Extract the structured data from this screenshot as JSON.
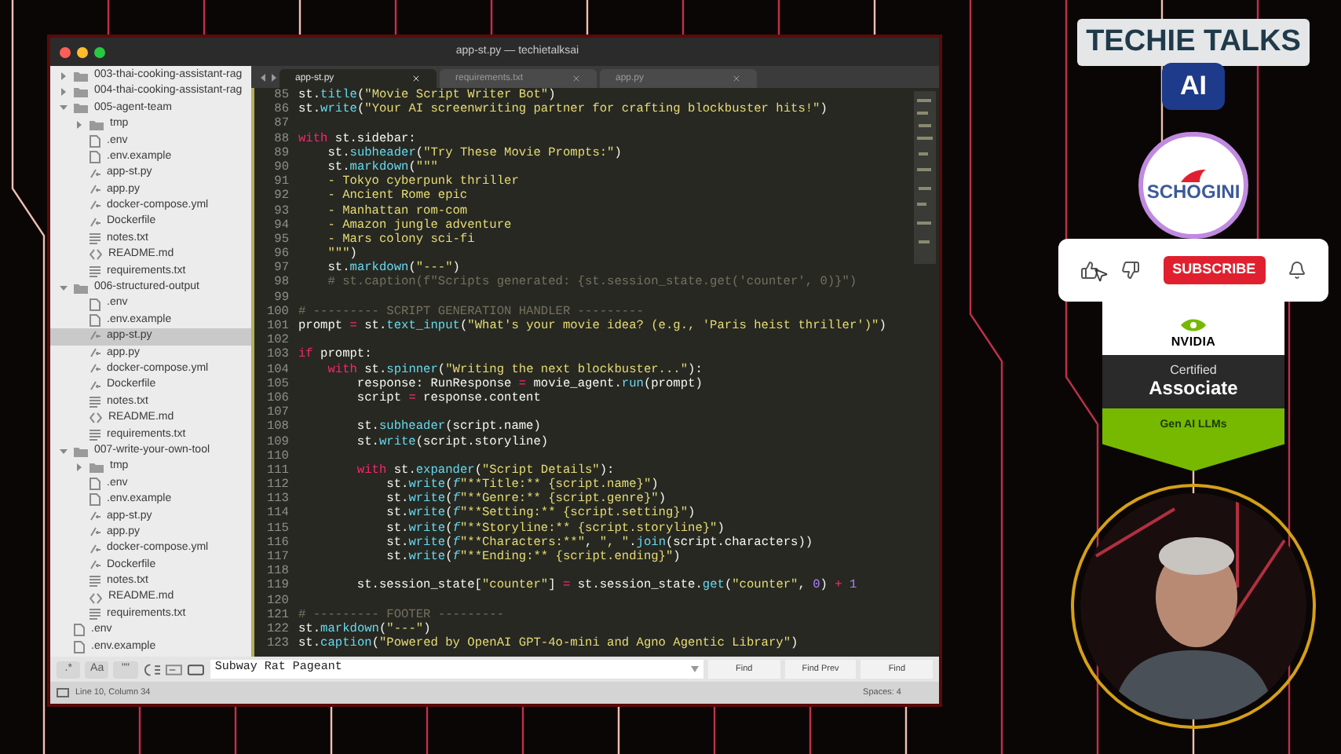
{
  "window": {
    "title": "app-st.py — techietalksai"
  },
  "sidebar": {
    "items": [
      {
        "label": "003-thai-cooking-assistant-rag",
        "kind": "folder",
        "expanded": false,
        "selected": false
      },
      {
        "label": "004-thai-cooking-assistant-rag",
        "kind": "folder",
        "expanded": false,
        "selected": false
      },
      {
        "label": "005-agent-team",
        "kind": "folder",
        "expanded": true,
        "selected": false,
        "children": [
          {
            "label": "tmp",
            "kind": "folder",
            "expanded": false,
            "selected": false
          },
          {
            "label": ".env",
            "kind": "file",
            "selected": false
          },
          {
            "label": ".env.example",
            "kind": "file",
            "selected": false
          },
          {
            "label": "app-st.py",
            "kind": "script",
            "selected": false
          },
          {
            "label": "app.py",
            "kind": "script",
            "selected": false
          },
          {
            "label": "docker-compose.yml",
            "kind": "script",
            "selected": false
          },
          {
            "label": "Dockerfile",
            "kind": "script",
            "selected": false
          },
          {
            "label": "notes.txt",
            "kind": "text",
            "selected": false
          },
          {
            "label": "README.md",
            "kind": "markup",
            "selected": false
          },
          {
            "label": "requirements.txt",
            "kind": "text",
            "selected": false
          }
        ]
      },
      {
        "label": "006-structured-output",
        "kind": "folder",
        "expanded": true,
        "selected": false,
        "children": [
          {
            "label": ".env",
            "kind": "file",
            "selected": false
          },
          {
            "label": ".env.example",
            "kind": "file",
            "selected": false
          },
          {
            "label": "app-st.py",
            "kind": "script",
            "selected": true
          },
          {
            "label": "app.py",
            "kind": "script",
            "selected": false
          },
          {
            "label": "docker-compose.yml",
            "kind": "script",
            "selected": false
          },
          {
            "label": "Dockerfile",
            "kind": "script",
            "selected": false
          },
          {
            "label": "notes.txt",
            "kind": "text",
            "selected": false
          },
          {
            "label": "README.md",
            "kind": "markup",
            "selected": false
          },
          {
            "label": "requirements.txt",
            "kind": "text",
            "selected": false
          }
        ]
      },
      {
        "label": "007-write-your-own-tool",
        "kind": "folder",
        "expanded": true,
        "selected": false,
        "children": [
          {
            "label": "tmp",
            "kind": "folder",
            "expanded": false,
            "selected": false
          },
          {
            "label": ".env",
            "kind": "file",
            "selected": false
          },
          {
            "label": ".env.example",
            "kind": "file",
            "selected": false
          },
          {
            "label": "app-st.py",
            "kind": "script",
            "selected": false
          },
          {
            "label": "app.py",
            "kind": "script",
            "selected": false
          },
          {
            "label": "docker-compose.yml",
            "kind": "script",
            "selected": false
          },
          {
            "label": "Dockerfile",
            "kind": "script",
            "selected": false
          },
          {
            "label": "notes.txt",
            "kind": "text",
            "selected": false
          },
          {
            "label": "README.md",
            "kind": "markup",
            "selected": false
          },
          {
            "label": "requirements.txt",
            "kind": "text",
            "selected": false
          }
        ]
      },
      {
        "label": ".env",
        "kind": "file",
        "selected": false
      },
      {
        "label": ".env.example",
        "kind": "file",
        "selected": false
      }
    ]
  },
  "tabs": [
    {
      "label": "app-st.py",
      "selected": true
    },
    {
      "label": "requirements.txt",
      "selected": false
    },
    {
      "label": "app.py",
      "selected": false
    }
  ],
  "editor": {
    "lines": [
      {
        "number": "85",
        "tokens": [
          {
            "kind": "plain",
            "text": "st."
          },
          {
            "kind": "call",
            "text": "title"
          },
          {
            "kind": "plain",
            "text": "("
          },
          {
            "kind": "string",
            "text": "\"Movie Script Writer Bot\""
          },
          {
            "kind": "plain",
            "text": ")"
          }
        ]
      },
      {
        "number": "86",
        "tokens": [
          {
            "kind": "plain",
            "text": "st."
          },
          {
            "kind": "call",
            "text": "write"
          },
          {
            "kind": "plain",
            "text": "("
          },
          {
            "kind": "string",
            "text": "\"Your AI screenwriting partner for crafting blockbuster hits!\""
          },
          {
            "kind": "plain",
            "text": ")"
          }
        ]
      },
      {
        "number": "87"
      },
      {
        "number": "88",
        "tokens": [
          {
            "kind": "keyword",
            "text": "with"
          },
          {
            "kind": "plain",
            "text": " st.sidebar:"
          }
        ]
      },
      {
        "number": "89",
        "tokens": [
          {
            "kind": "plain",
            "text": "    st."
          },
          {
            "kind": "call",
            "text": "subheader"
          },
          {
            "kind": "plain",
            "text": "("
          },
          {
            "kind": "string",
            "text": "\"Try These Movie Prompts:\""
          },
          {
            "kind": "plain",
            "text": ")"
          }
        ]
      },
      {
        "number": "90",
        "tokens": [
          {
            "kind": "plain",
            "text": "    st."
          },
          {
            "kind": "call",
            "text": "markdown"
          },
          {
            "kind": "plain",
            "text": "("
          },
          {
            "kind": "string",
            "text": "\"\"\""
          }
        ]
      },
      {
        "number": "91",
        "tokens": [
          {
            "kind": "string",
            "text": "    - Tokyo cyberpunk thriller"
          }
        ]
      },
      {
        "number": "92",
        "tokens": [
          {
            "kind": "string",
            "text": "    - Ancient Rome epic"
          }
        ]
      },
      {
        "number": "93",
        "tokens": [
          {
            "kind": "string",
            "text": "    - Manhattan rom-com"
          }
        ]
      },
      {
        "number": "94",
        "tokens": [
          {
            "kind": "string",
            "text": "    - Amazon jungle adventure"
          }
        ]
      },
      {
        "number": "95",
        "tokens": [
          {
            "kind": "string",
            "text": "    - Mars colony sci-fi"
          }
        ]
      },
      {
        "number": "96",
        "tokens": [
          {
            "kind": "string",
            "text": "    \"\"\""
          },
          {
            "kind": "plain",
            "text": ")"
          }
        ]
      },
      {
        "number": "97",
        "tokens": [
          {
            "kind": "plain",
            "text": "    st."
          },
          {
            "kind": "call",
            "text": "markdown"
          },
          {
            "kind": "plain",
            "text": "("
          },
          {
            "kind": "string",
            "text": "\"---\""
          },
          {
            "kind": "plain",
            "text": ")"
          }
        ]
      },
      {
        "number": "98",
        "tokens": [
          {
            "kind": "comment",
            "text": "    # st.caption(f\"Scripts generated: {st.session_state.get('counter', 0)}\")"
          }
        ]
      },
      {
        "number": "99"
      },
      {
        "number": "100",
        "tokens": [
          {
            "kind": "comment",
            "text": "# --------- SCRIPT GENERATION HANDLER ---------"
          }
        ]
      },
      {
        "number": "101",
        "tokens": [
          {
            "kind": "plain",
            "text": "prompt "
          },
          {
            "kind": "keyword",
            "text": "="
          },
          {
            "kind": "plain",
            "text": " st."
          },
          {
            "kind": "call",
            "text": "text_input"
          },
          {
            "kind": "plain",
            "text": "("
          },
          {
            "kind": "string",
            "text": "\"What's your movie idea? (e.g., 'Paris heist thriller')\""
          },
          {
            "kind": "plain",
            "text": ")"
          }
        ]
      },
      {
        "number": "102"
      },
      {
        "number": "103",
        "tokens": [
          {
            "kind": "keyword",
            "text": "if"
          },
          {
            "kind": "plain",
            "text": " prompt:"
          }
        ]
      },
      {
        "number": "104",
        "tokens": [
          {
            "kind": "keyword",
            "text": "    with"
          },
          {
            "kind": "plain",
            "text": " st."
          },
          {
            "kind": "call",
            "text": "spinner"
          },
          {
            "kind": "plain",
            "text": "("
          },
          {
            "kind": "string",
            "text": "\"Writing the next blockbuster...\""
          },
          {
            "kind": "plain",
            "text": "):"
          }
        ]
      },
      {
        "number": "105",
        "tokens": [
          {
            "kind": "plain",
            "text": "        response: RunResponse "
          },
          {
            "kind": "keyword",
            "text": "="
          },
          {
            "kind": "plain",
            "text": " movie_agent."
          },
          {
            "kind": "call",
            "text": "run"
          },
          {
            "kind": "plain",
            "text": "(prompt)"
          }
        ]
      },
      {
        "number": "106",
        "tokens": [
          {
            "kind": "plain",
            "text": "        script "
          },
          {
            "kind": "keyword",
            "text": "="
          },
          {
            "kind": "plain",
            "text": " response.content"
          }
        ]
      },
      {
        "number": "107"
      },
      {
        "number": "108",
        "tokens": [
          {
            "kind": "plain",
            "text": "        st."
          },
          {
            "kind": "call",
            "text": "subheader"
          },
          {
            "kind": "plain",
            "text": "(script.name)"
          }
        ]
      },
      {
        "number": "109",
        "tokens": [
          {
            "kind": "plain",
            "text": "        st."
          },
          {
            "kind": "call",
            "text": "write"
          },
          {
            "kind": "plain",
            "text": "(script.storyline)"
          }
        ]
      },
      {
        "number": "110"
      },
      {
        "number": "111",
        "tokens": [
          {
            "kind": "keyword",
            "text": "        with"
          },
          {
            "kind": "plain",
            "text": " st."
          },
          {
            "kind": "call",
            "text": "expander"
          },
          {
            "kind": "plain",
            "text": "("
          },
          {
            "kind": "string",
            "text": "\"Script Details\""
          },
          {
            "kind": "plain",
            "text": "):"
          }
        ]
      },
      {
        "number": "112",
        "tokens": [
          {
            "kind": "plain",
            "text": "            st."
          },
          {
            "kind": "call",
            "text": "write"
          },
          {
            "kind": "plain",
            "text": "("
          },
          {
            "kind": "prefix",
            "text": "f"
          },
          {
            "kind": "string",
            "text": "\"**Title:** {script.name}\""
          },
          {
            "kind": "plain",
            "text": ")"
          }
        ]
      },
      {
        "number": "113",
        "tokens": [
          {
            "kind": "plain",
            "text": "            st."
          },
          {
            "kind": "call",
            "text": "write"
          },
          {
            "kind": "plain",
            "text": "("
          },
          {
            "kind": "prefix",
            "text": "f"
          },
          {
            "kind": "string",
            "text": "\"**Genre:** {script.genre}\""
          },
          {
            "kind": "plain",
            "text": ")"
          }
        ]
      },
      {
        "number": "114",
        "tokens": [
          {
            "kind": "plain",
            "text": "            st."
          },
          {
            "kind": "call",
            "text": "write"
          },
          {
            "kind": "plain",
            "text": "("
          },
          {
            "kind": "prefix",
            "text": "f"
          },
          {
            "kind": "string",
            "text": "\"**Setting:** {script.setting}\""
          },
          {
            "kind": "plain",
            "text": ")"
          }
        ]
      },
      {
        "number": "115",
        "tokens": [
          {
            "kind": "plain",
            "text": "            st."
          },
          {
            "kind": "call",
            "text": "write"
          },
          {
            "kind": "plain",
            "text": "("
          },
          {
            "kind": "prefix",
            "text": "f"
          },
          {
            "kind": "string",
            "text": "\"**Storyline:** {script.storyline}\""
          },
          {
            "kind": "plain",
            "text": ")"
          }
        ]
      },
      {
        "number": "116",
        "tokens": [
          {
            "kind": "plain",
            "text": "            st."
          },
          {
            "kind": "call",
            "text": "write"
          },
          {
            "kind": "plain",
            "text": "("
          },
          {
            "kind": "prefix",
            "text": "f"
          },
          {
            "kind": "string",
            "text": "\"**Characters:**\""
          },
          {
            "kind": "plain",
            "text": ", "
          },
          {
            "kind": "string",
            "text": "\", \""
          },
          {
            "kind": "plain",
            "text": "."
          },
          {
            "kind": "call",
            "text": "join"
          },
          {
            "kind": "plain",
            "text": "(script.characters))"
          }
        ]
      },
      {
        "number": "117",
        "tokens": [
          {
            "kind": "plain",
            "text": "            st."
          },
          {
            "kind": "call",
            "text": "write"
          },
          {
            "kind": "plain",
            "text": "("
          },
          {
            "kind": "prefix",
            "text": "f"
          },
          {
            "kind": "string",
            "text": "\"**Ending:** {script.ending}\""
          },
          {
            "kind": "plain",
            "text": ")"
          }
        ]
      },
      {
        "number": "118"
      },
      {
        "number": "119",
        "tokens": [
          {
            "kind": "plain",
            "text": "        st.session_state["
          },
          {
            "kind": "string",
            "text": "\"counter\""
          },
          {
            "kind": "plain",
            "text": "] "
          },
          {
            "kind": "keyword",
            "text": "="
          },
          {
            "kind": "plain",
            "text": " st.session_state."
          },
          {
            "kind": "call",
            "text": "get"
          },
          {
            "kind": "plain",
            "text": "("
          },
          {
            "kind": "string",
            "text": "\"counter\""
          },
          {
            "kind": "plain",
            "text": ", "
          },
          {
            "kind": "number",
            "text": "0"
          },
          {
            "kind": "plain",
            "text": ") "
          },
          {
            "kind": "keyword",
            "text": "+"
          },
          {
            "kind": "number",
            "text": " 1"
          }
        ]
      },
      {
        "number": "120"
      },
      {
        "number": "121",
        "tokens": [
          {
            "kind": "comment",
            "text": "# --------- FOOTER ---------"
          }
        ]
      },
      {
        "number": "122",
        "tokens": [
          {
            "kind": "plain",
            "text": "st."
          },
          {
            "kind": "call",
            "text": "markdown"
          },
          {
            "kind": "plain",
            "text": "("
          },
          {
            "kind": "string",
            "text": "\"---\""
          },
          {
            "kind": "plain",
            "text": ")"
          }
        ]
      },
      {
        "number": "123",
        "tokens": [
          {
            "kind": "plain",
            "text": "st."
          },
          {
            "kind": "call",
            "text": "caption"
          },
          {
            "kind": "plain",
            "text": "("
          },
          {
            "kind": "string",
            "text": "\"Powered by OpenAI GPT-4o-mini and Agno Agentic Library\""
          },
          {
            "kind": "plain",
            "text": ")"
          }
        ]
      }
    ]
  },
  "find_bar": {
    "options": [
      ".*",
      "Aa",
      "\"\""
    ],
    "query": "Subway Rat Pageant",
    "buttons": [
      "Find",
      "Find Prev",
      "Find"
    ]
  },
  "status_bar": {
    "position": "Line 10, Column 34",
    "indentation": "Spaces: 4"
  },
  "overlay": {
    "brand": "TECHIE TALKS",
    "brand_badge": "AI",
    "logo": "SCHOGINI",
    "subscribe": "SUBSCRIBE",
    "certification": {
      "vendor": "NVIDIA",
      "line_1": "Certified",
      "line_2": "Associate",
      "track": "Gen AI LLMs"
    }
  }
}
